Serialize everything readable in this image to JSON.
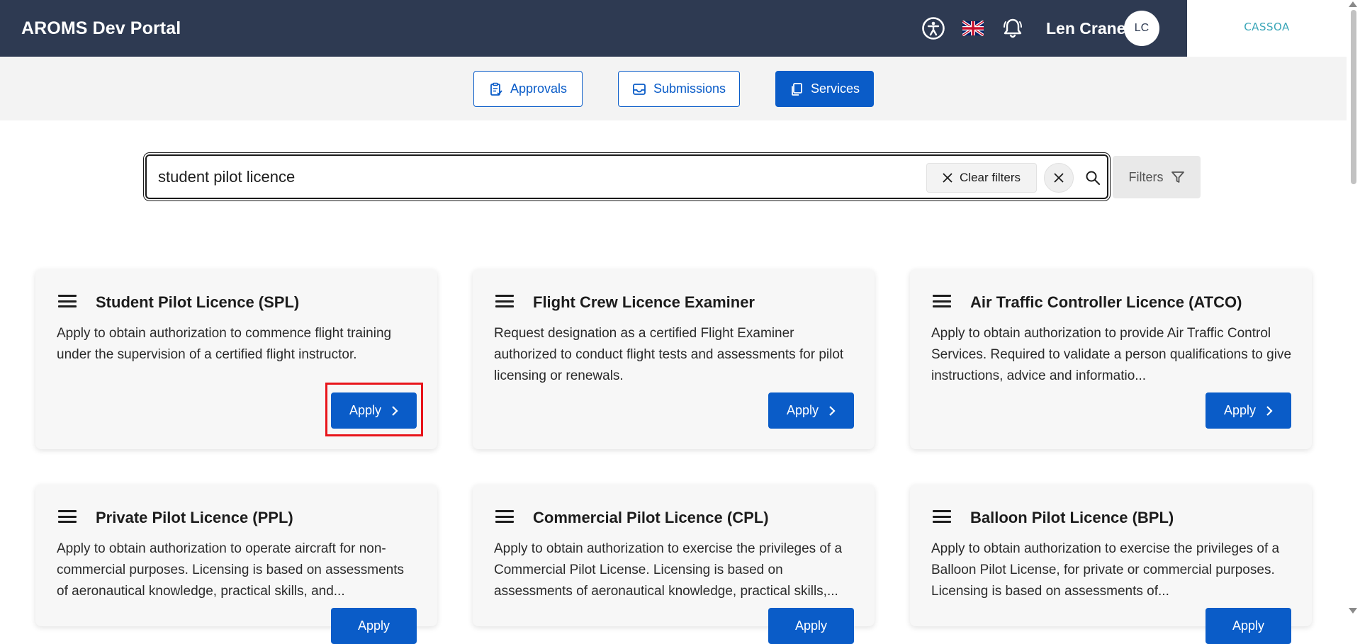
{
  "header": {
    "app_title": "AROMS Dev Portal",
    "icons": [
      "accessibility-icon",
      "uk-flag-icon",
      "bell-icon"
    ],
    "user_name": "Len Crane",
    "avatar_initials": "LC",
    "logo_text": "CASSOA"
  },
  "nav": {
    "tabs": [
      {
        "label": "Approvals",
        "icon": "clipboard-icon",
        "active": false
      },
      {
        "label": "Submissions",
        "icon": "inbox-icon",
        "active": false
      },
      {
        "label": "Services",
        "icon": "copy-icon",
        "active": true
      }
    ]
  },
  "search": {
    "value": "student pilot licence",
    "clear_filters_label": "Clear filters",
    "filters_label": "Filters"
  },
  "cards": [
    {
      "title": "Student Pilot Licence (SPL)",
      "description": "Apply to obtain authorization to commence flight training under the supervision of a certified flight instructor.",
      "button": "Apply"
    },
    {
      "title": "Flight Crew Licence Examiner",
      "description": "Request designation as a certified Flight Examiner authorized to conduct flight tests and assessments for pilot licensing or renewals.",
      "button": "Apply"
    },
    {
      "title": "Air Traffic Controller Licence (ATCO)",
      "description": "Apply to obtain authorization to provide Air Traffic Control Services. Required to validate a person qualifications to give instructions, advice and informatio...",
      "button": "Apply"
    },
    {
      "title": "Private Pilot Licence (PPL)",
      "description": "Apply to obtain authorization to operate aircraft for non-commercial purposes. Licensing is based on assessments of aeronautical knowledge, practical skills, and...",
      "button": "Apply"
    },
    {
      "title": "Commercial Pilot Licence (CPL)",
      "description": "Apply to obtain authorization to exercise the privileges of a Commercial Pilot License. Licensing is based on assessments of aeronautical knowledge, practical skills,...",
      "button": "Apply"
    },
    {
      "title": "Balloon Pilot Licence (BPL)",
      "description": "Apply to obtain authorization to exercise the privileges of a Balloon Pilot License, for private or commercial purposes. Licensing is based on assessments of...",
      "button": "Apply"
    }
  ],
  "colors": {
    "header_bg": "#2e3a52",
    "primary": "#0a5cc8",
    "highlight": "#e8151b"
  }
}
